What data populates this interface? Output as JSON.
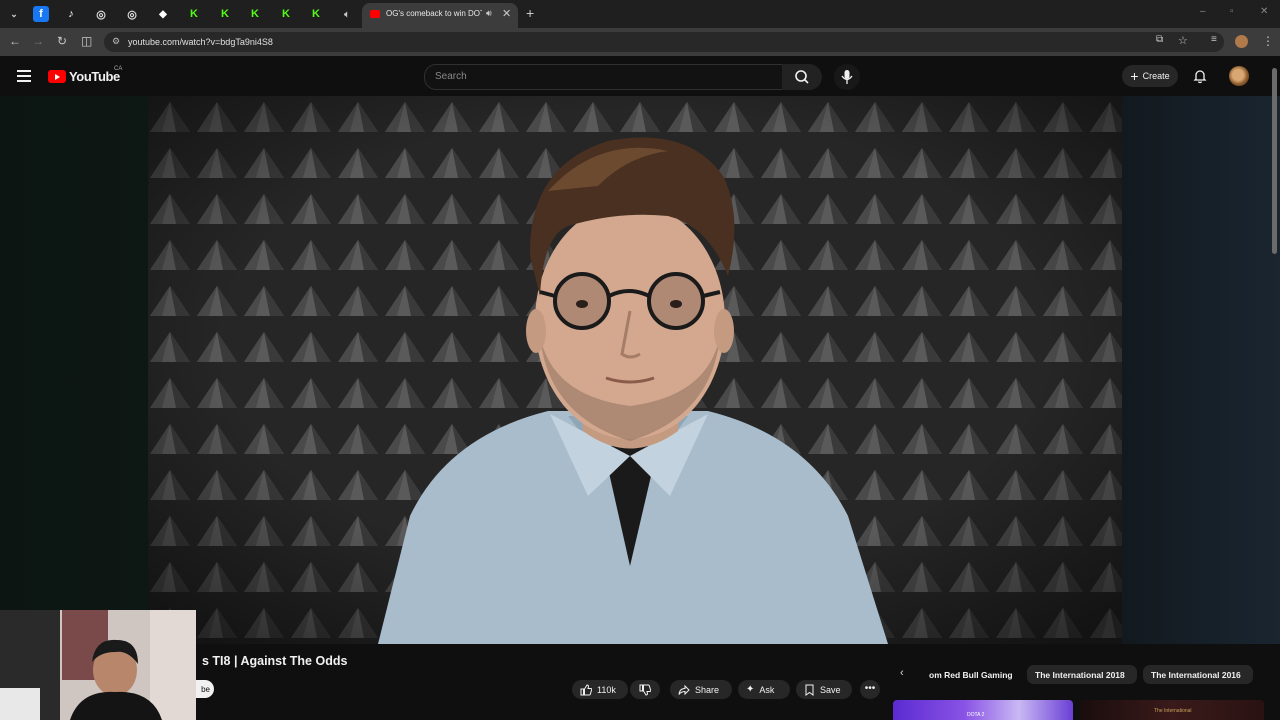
{
  "browser": {
    "active_tab": {
      "title": "OG's comeback to win DOTA",
      "audio_icon": "speaker-icon",
      "close": "✕"
    },
    "new_tab": "+",
    "url": "youtube.com/watch?v=bdgTa9ni4S8",
    "window_controls": [
      "–",
      "▫",
      "✕"
    ]
  },
  "youtube": {
    "logo_text": "YouTube",
    "region": "CA",
    "search_placeholder": "Search",
    "create_label": "Create"
  },
  "video": {
    "title_visible": "s TI8 | Against The Odds",
    "subscribe_partial": "be",
    "likes": "110k",
    "share_label": "Share",
    "ask_label": "Ask",
    "save_label": "Save",
    "more_label": "•••"
  },
  "chips": {
    "prev_arrow": "‹",
    "items": [
      "om Red Bull Gaming",
      "The International 2018",
      "The International 2016"
    ]
  },
  "thumbnails": [
    "DOTA 2",
    "The International"
  ],
  "colors": {
    "brand_red": "#ff0000",
    "background": "#0f0f0f",
    "chip_bg": "#272727"
  }
}
